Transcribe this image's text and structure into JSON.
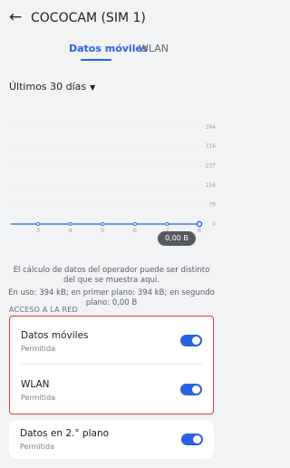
{
  "header": {
    "back_glyph": "←",
    "title": "COCOCAM (SIM 1)"
  },
  "tabs": [
    {
      "label": "Datos móviles",
      "active": true
    },
    {
      "label": "WLAN",
      "active": false
    }
  ],
  "period": {
    "label": "Últimos 30 días",
    "caret": "▼"
  },
  "chart_data": {
    "type": "line",
    "title": "",
    "xlabel": "",
    "ylabel": "",
    "x": [
      3,
      4,
      5,
      6,
      7,
      8
    ],
    "series": [
      {
        "values": [
          0,
          0,
          0,
          0,
          0,
          0
        ]
      }
    ],
    "y_ticks": [
      "394",
      "316",
      "237",
      "158",
      "79",
      "0"
    ],
    "x_ticks": [
      "3",
      "4",
      "5",
      "6",
      "7",
      "8"
    ],
    "ylim": [
      0,
      394
    ],
    "tooltip": "0,00 B",
    "colors": {
      "line": "#2a62e4",
      "tooltip_bg": "#555a5f"
    }
  },
  "notes": {
    "disclaimer": "El cálculo de datos del operador puede ser distinto del que se muestra aquí.",
    "usage": "En uso: 394 kB; en primer plano: 394 kB; en segundo plano: 0,00 B"
  },
  "section": {
    "title": "ACCESO A LA RED"
  },
  "network_access": [
    {
      "label": "Datos móviles",
      "status": "Permitida",
      "enabled": true
    },
    {
      "label": "WLAN",
      "status": "Permitida",
      "enabled": true
    }
  ],
  "background_data": {
    "label": "Datos en 2.° plano",
    "status": "Permitida",
    "enabled": true
  },
  "colors": {
    "accent": "#2a62e4",
    "highlight_border": "#e53935"
  }
}
